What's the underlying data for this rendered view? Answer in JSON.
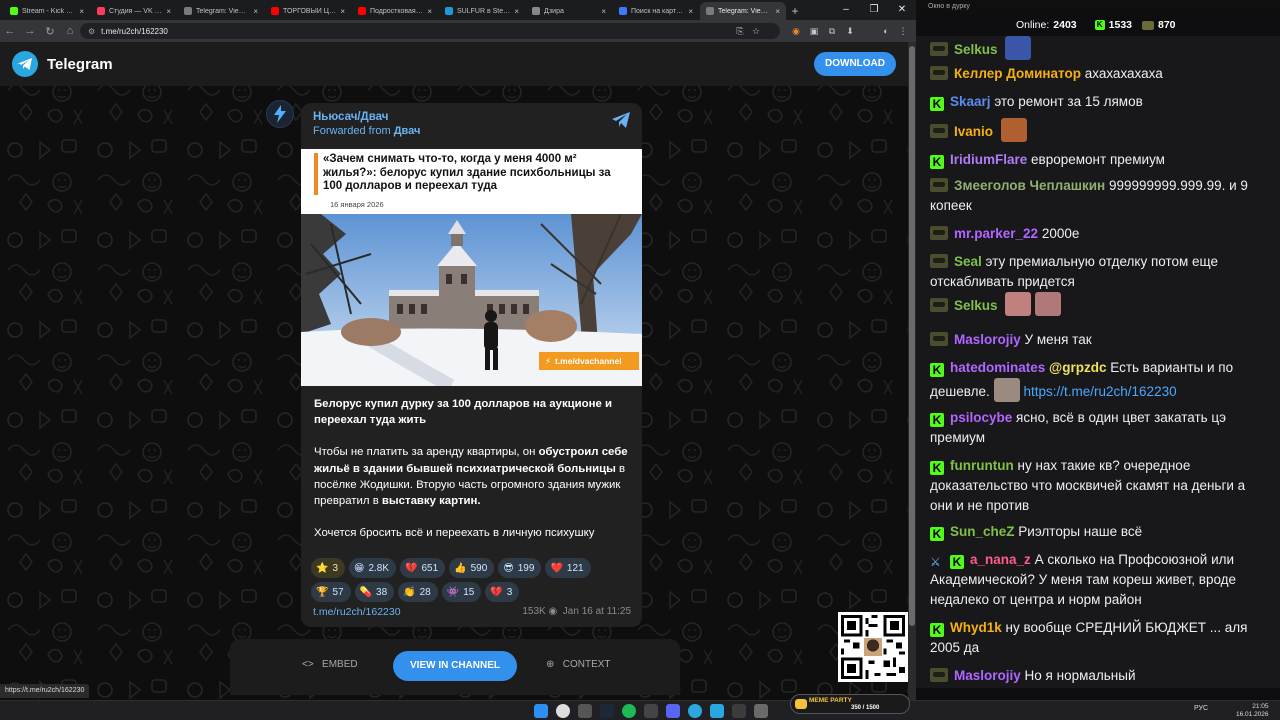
{
  "browser": {
    "tabs": [
      {
        "title": "Stream - Kick Dashb",
        "color": "#53fc18"
      },
      {
        "title": "Студия — VK Видео",
        "color": "#ff3b5c"
      },
      {
        "title": "Telegram: View @ru2ch",
        "color": "#7a7a7a"
      },
      {
        "title": "ТОРГОВЫЙ ЦЕНТР",
        "color": "#ff0000"
      },
      {
        "title": "Подростковая \"ко",
        "color": "#ff0000"
      },
      {
        "title": "SULFUR в Steam",
        "color": "#1b9ad6"
      },
      {
        "title": "Дзира",
        "color": "#888888"
      },
      {
        "title": "Поиск на карте Ц",
        "color": "#3b7bff"
      },
      {
        "title": "Telegram: View @",
        "color": "#7a7a7a"
      }
    ],
    "url": "t.me/ru2ch/162230",
    "status_url": "https://t.me/ru2ch/162230"
  },
  "telegram": {
    "brand": "Telegram",
    "download_label": "DOWNLOAD",
    "post": {
      "channel": "Ньюсач/Двач",
      "forwarded_prefix": "Forwarded from",
      "forwarded_from": "Двач",
      "article_title": "«Зачем снимать что-то, когда у меня 4000 м² жилья?»: белорус купил здание психбольницы за 100 долларов и переехал туда",
      "article_date": "16 января 2026",
      "watermark": "t.me/dvachannel",
      "headline": "Белорус купил дурку за 100 долларов на аукционе и переехал туда жить",
      "body_1": "Чтобы не платить за аренду квартиры, он ",
      "body_2": "обустроил себе жильё в здании бывшей психиатрической больницы",
      "body_3": " в посёлке Жодишки. Вторую часть огромного здания мужик превратил в ",
      "body_4": "выставку картин.",
      "closing": "Хочется бросить всё и переехать в личную психушку",
      "reactions_row1": [
        {
          "emoji": "⭐",
          "count": "3",
          "chosen": true
        },
        {
          "emoji": "😁",
          "count": "2.8K"
        },
        {
          "emoji": "💔",
          "count": "651"
        },
        {
          "emoji": "👍",
          "count": "590"
        },
        {
          "emoji": "😎",
          "count": "199"
        },
        {
          "emoji": "❤️",
          "count": "121"
        }
      ],
      "reactions_row2": [
        {
          "emoji": "🏆",
          "count": "57"
        },
        {
          "emoji": "💊",
          "count": "38"
        },
        {
          "emoji": "👏",
          "count": "28"
        },
        {
          "emoji": "👾",
          "count": "15"
        },
        {
          "emoji": "💔",
          "count": "3"
        }
      ],
      "link": "t.me/ru2ch/162230",
      "views": "153K",
      "date": "Jan 16 at 11:25"
    },
    "bottom": {
      "embed": "EMBED",
      "view": "VIEW IN CHANNEL",
      "context": "CONTEXT"
    }
  },
  "chat": {
    "window_title": "Окно в дурку",
    "online_label": "Online:",
    "online": "2403",
    "score1": "1533",
    "score2": "870",
    "messages": [
      {
        "user": "Selkus",
        "color": "#7fc04a",
        "badge": "glass",
        "text": "",
        "emote": "#3a56a8"
      },
      {
        "user": "Келлер Доминатор",
        "color": "#f5b014",
        "badge": "glass",
        "text": "ахахахахаха"
      },
      {
        "user": "Skaarj",
        "color": "#5b8cf0",
        "badge": "kick",
        "text": "это ремонт за 15 лямов"
      },
      {
        "user": "Ivanio",
        "color": "#f5b014",
        "badge": "glass",
        "text": "",
        "emote": "#b06030"
      },
      {
        "user": "IridiumFlare",
        "color": "#b07cf5",
        "badge": "kick",
        "text": "евроремонт премиум"
      },
      {
        "user": "Змееголов Чеплашкин",
        "color": "#8fb070",
        "badge": "glass",
        "text": "999999999.999.99. и 9 копеек"
      },
      {
        "user": "mr.parker_22",
        "color": "#b066ff",
        "badge": "glass",
        "text": "2000е"
      },
      {
        "user": "Seal",
        "color": "#7fc04a",
        "badge": "glass",
        "text": "эту премиальную отделку потом еще отскабливать придется"
      },
      {
        "user": "Selkus",
        "color": "#7fc04a",
        "badge": "glass",
        "text": "",
        "emote": "#c08080"
      },
      {
        "user": "Maslorojiy",
        "color": "#b066ff",
        "badge": "glass",
        "text": "У меня так"
      },
      {
        "user": "hatedominates",
        "color": "#b066ff",
        "badge": "kick",
        "mention": "@grpzdc",
        "text": "Есть варианты и по дешевле.",
        "link": "https://t.me/ru2ch/162230"
      },
      {
        "user": "psilocybe",
        "color": "#b066ff",
        "badge": "kick",
        "text": "ясно, всё в один цвет закатать цэ премиум"
      },
      {
        "user": "funruntun",
        "color": "#7fc04a",
        "badge": "kick",
        "text": "ну нах такие кв? очередное доказательство что москвичей скамят на деньги а они и не против"
      },
      {
        "user": "Sun_cheZ",
        "color": "#7fc04a",
        "badge": "kick",
        "text": "Риэлторы наше всё"
      },
      {
        "user": "a_nana_z",
        "color": "#ff5a8a",
        "badge": "sword",
        "text": "А сколько на Профсоюзной или Академической? У меня там кореш живет, вроде недалеко от центра и норм район"
      },
      {
        "user": "Whyd1k",
        "color": "#f5b014",
        "badge": "kick",
        "text": "ну вообще СРЕДНИЙ БЮДЖЕТ ... аля 2005 да"
      },
      {
        "user": "Maslorojiy",
        "color": "#b066ff",
        "badge": "glass",
        "text": "Но я нормальный"
      }
    ]
  },
  "taskbar": {
    "lang": "РУС",
    "time": "21:05",
    "date": "16.01.2026",
    "meme": "MEME PARTY",
    "meme_count": "350 / 1500"
  }
}
